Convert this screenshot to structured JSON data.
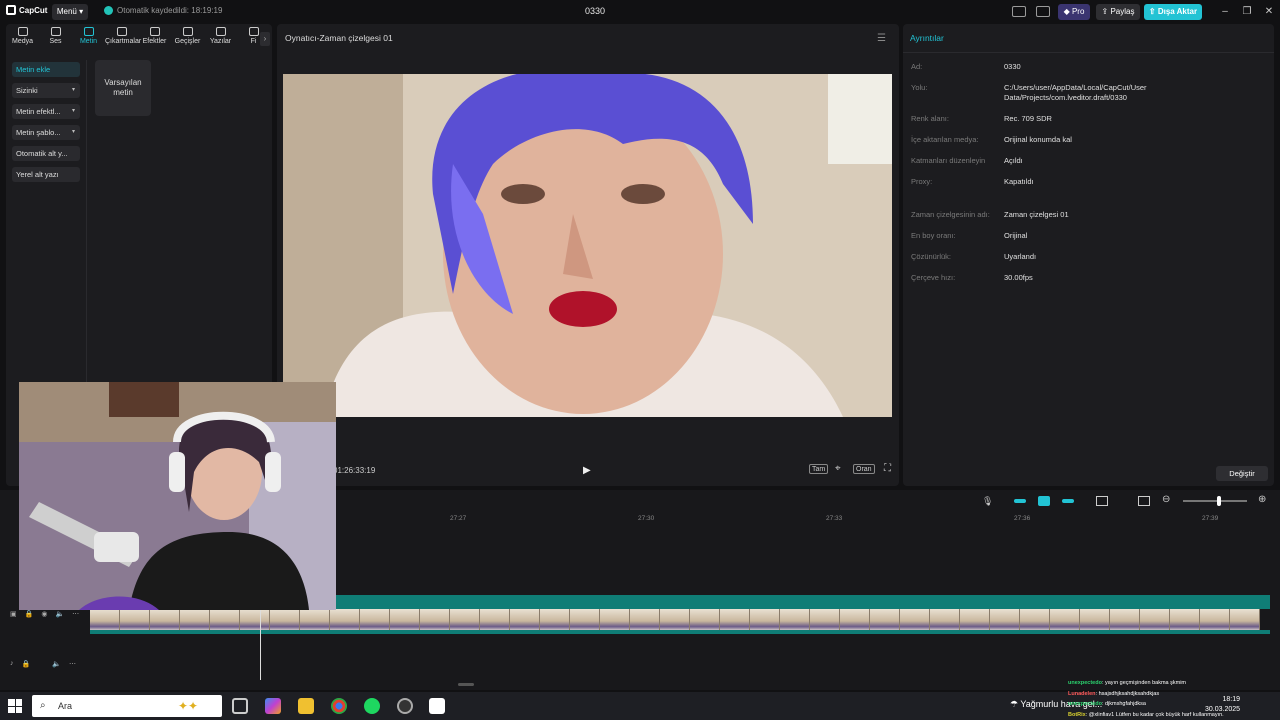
{
  "app": {
    "logo_text": "CapCut",
    "menu_label": "Menü",
    "autosave_text": "Otomatik kaydedildi: 18:19:19",
    "project_title": "0330",
    "pro_label": "Pro",
    "share_label": "Paylaş",
    "export_label": "Dışa Aktar"
  },
  "tabs": [
    {
      "label": "Medya",
      "icon": "media-icon"
    },
    {
      "label": "Ses",
      "icon": "audio-icon"
    },
    {
      "label": "Metin",
      "icon": "text-icon",
      "active": true
    },
    {
      "label": "Çıkartmalar",
      "icon": "sticker-icon"
    },
    {
      "label": "Efektler",
      "icon": "effects-icon"
    },
    {
      "label": "Geçişler",
      "icon": "transitions-icon"
    },
    {
      "label": "Yazılar",
      "icon": "captions-icon"
    },
    {
      "label": "Fi",
      "icon": "filters-icon"
    }
  ],
  "side_menu": [
    {
      "label": "Metin ekle",
      "active": true,
      "chevron": false
    },
    {
      "label": "Sizinki",
      "chevron": true
    },
    {
      "label": "Metin efektl...",
      "chevron": true
    },
    {
      "label": "Metin şablo...",
      "chevron": true
    },
    {
      "label": "Otomatik alt y...",
      "chevron": false
    },
    {
      "label": "Yerel alt yazı",
      "chevron": false
    }
  ],
  "default_text_card": {
    "line1": "Varsayılan",
    "line2": "metin"
  },
  "player": {
    "title": "Oynatıcı-Zaman çizelgesi 01",
    "timecode": "01:26:33:19",
    "full_label": "Tam",
    "ratio_label": "Oran"
  },
  "details": {
    "title": "Ayrıntılar",
    "rows": [
      {
        "label": "Ad:",
        "value": "0330"
      },
      {
        "label": "Yolu:",
        "value": "C:/Users/user/AppData/Local/CapCut/User Data/Projects/com.lveditor.draft/0330"
      },
      {
        "label": "Renk alanı:",
        "value": "Rec. 709 SDR"
      },
      {
        "label": "İçe aktarılan medya:",
        "value": "Orijinal konumda kal"
      },
      {
        "label": "Katmanları düzenleyin",
        "value": "Açıldı"
      },
      {
        "label": "Proxy:",
        "value": "Kapatıldı"
      },
      {
        "label": "Zaman çizelgesinin adı:",
        "value": "Zaman çizelgesi 01"
      },
      {
        "label": "En boy oranı:",
        "value": "Orijinal"
      },
      {
        "label": "Çözünürlük:",
        "value": "Uyarlandı"
      },
      {
        "label": "Çerçeve hızı:",
        "value": "30.00fps"
      }
    ],
    "change_label": "Değiştir"
  },
  "timeline": {
    "ticks": [
      "27:27",
      "27:30",
      "27:33",
      "27:36",
      "27:39"
    ]
  },
  "taskbar": {
    "search_placeholder": "Ara",
    "weather": "Yağmurlu hava gel...",
    "time": "18:19",
    "date": "30.03.2025"
  },
  "chat": [
    {
      "user": "unexpectedo",
      "text": ": yayın geçmişinden bakma şkmim",
      "color": "#2bd46f"
    },
    {
      "user": "Lunadelen",
      "text": ": hsajsdhjksahdjksahdkjas",
      "color": "#ff5a5a"
    },
    {
      "user": "unexpectedo",
      "text": ": djkmshgfahjdksa",
      "color": "#2bd46f"
    },
    {
      "user": "BotRix",
      "text": ": @xlinfiav1 Lütfen bu kadar çok büyük harf kullanmayın.",
      "color": "#d8d030"
    }
  ],
  "colors": {
    "accent": "#22c3d4",
    "teal_track": "#0f7d76"
  }
}
